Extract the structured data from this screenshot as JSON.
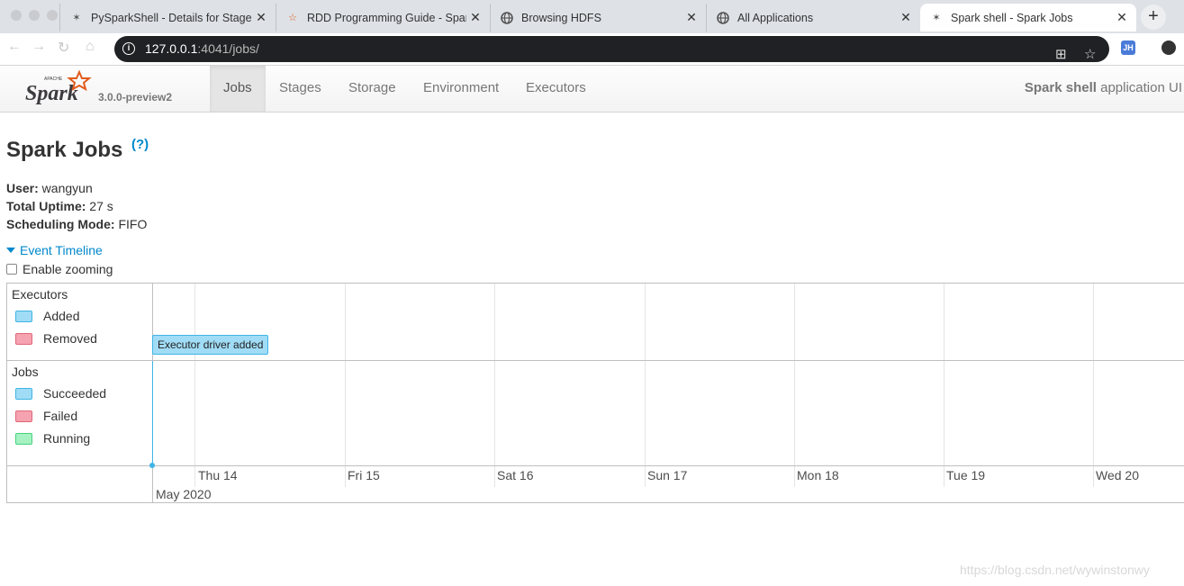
{
  "browser": {
    "tabs": [
      {
        "title": "PySparkShell - Details for Stage",
        "favicon": "spark-favicon",
        "active": false
      },
      {
        "title": "RDD Programming Guide - Spark",
        "favicon": "spark-star-favicon",
        "active": false
      },
      {
        "title": "Browsing HDFS",
        "favicon": "globe-favicon",
        "active": false
      },
      {
        "title": "All Applications",
        "favicon": "globe-favicon",
        "active": false
      },
      {
        "title": "Spark shell - Spark Jobs",
        "favicon": "spark-favicon",
        "active": true
      }
    ],
    "url_host": "127.0.0.1",
    "url_path": ":4041/jobs/",
    "extension_label": "JH"
  },
  "spark": {
    "version": "3.0.0-preview2",
    "nav": [
      "Jobs",
      "Stages",
      "Storage",
      "Environment",
      "Executors"
    ],
    "active_nav": "Jobs",
    "app_name_bold": "Spark shell",
    "app_name_suffix": " application UI"
  },
  "page": {
    "title": "Spark Jobs",
    "help": "(?)",
    "user_label": "User:",
    "user": " wangyun",
    "uptime_label": "Total Uptime:",
    "uptime": " 27 s",
    "sched_label": "Scheduling Mode:",
    "sched": " FIFO",
    "event_timeline": "Event Timeline",
    "enable_zooming": "Enable zooming"
  },
  "timeline": {
    "executors_title": "Executors",
    "executors_legend": [
      {
        "label": "Added",
        "color": "#a0dcf6",
        "border": "#3eb5e5"
      },
      {
        "label": "Removed",
        "color": "#f5a3b0",
        "border": "#e0667a"
      }
    ],
    "jobs_title": "Jobs",
    "jobs_legend": [
      {
        "label": "Succeeded",
        "color": "#a0dcf6",
        "border": "#3eb5e5"
      },
      {
        "label": "Failed",
        "color": "#f5a3b0",
        "border": "#e0667a"
      },
      {
        "label": "Running",
        "color": "#a6f2c2",
        "border": "#45d17d"
      }
    ],
    "event": "Executor driver added",
    "days": [
      "Thu 14",
      "Fri 15",
      "Sat 16",
      "Sun 17",
      "Mon 18",
      "Tue 19",
      "Wed 20"
    ],
    "month": "May 2020"
  },
  "watermark": "https://blog.csdn.net/wywinstonwy"
}
